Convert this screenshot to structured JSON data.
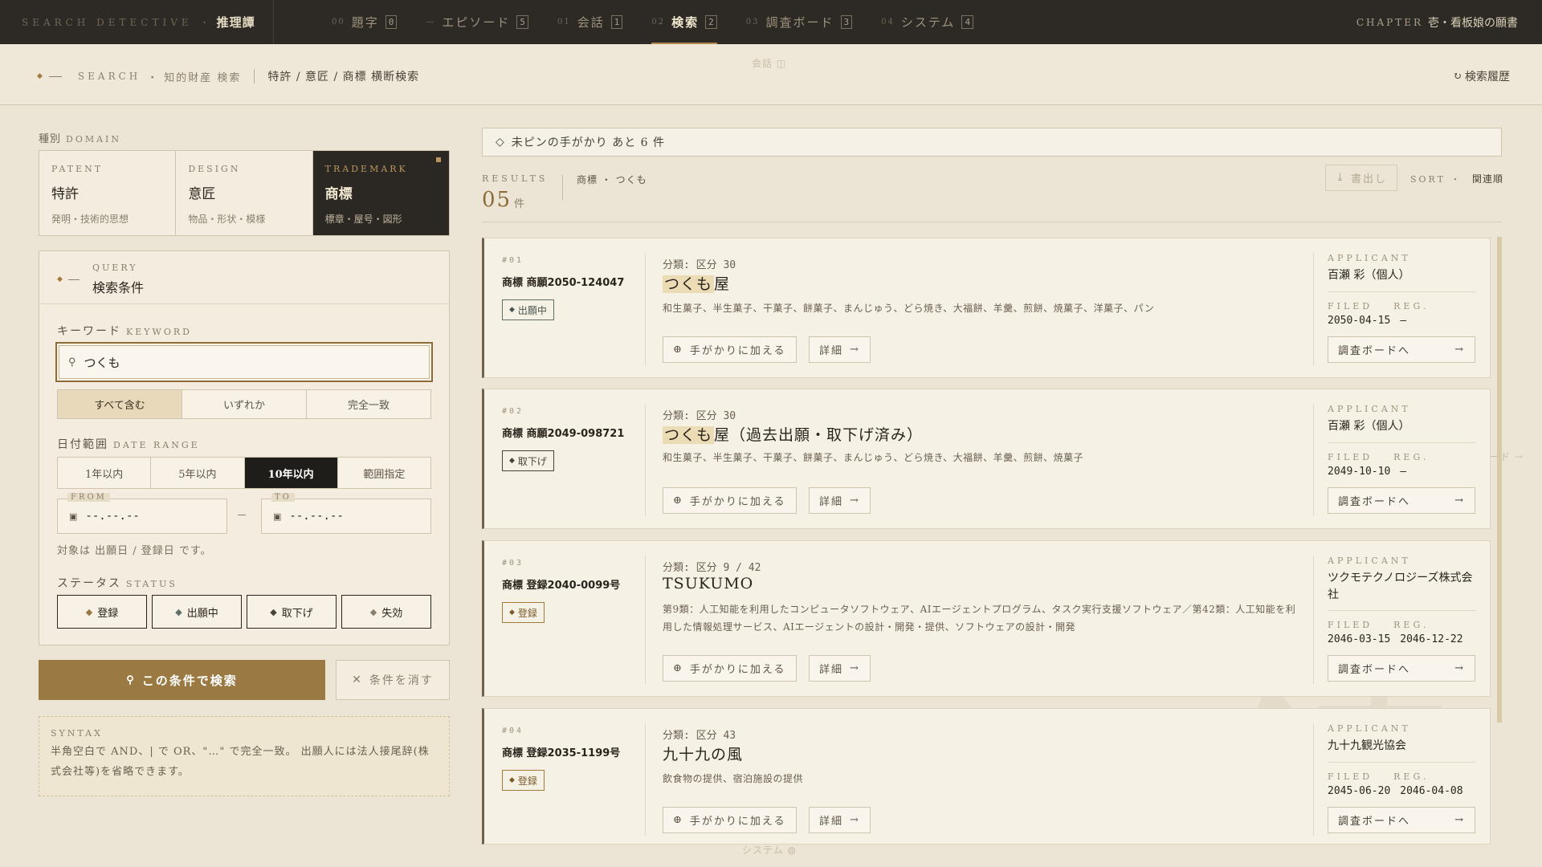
{
  "topbar": {
    "brand_en": "SEARCH DETECTIVE",
    "brand_dot": "・",
    "brand_jp": "推理譚",
    "tabs": [
      {
        "num": "00",
        "label": "題字",
        "key": "0"
      },
      {
        "num": "—",
        "label": "エピソード",
        "key": "5"
      },
      {
        "num": "01",
        "label": "会話",
        "key": "1"
      },
      {
        "num": "02",
        "label": "検索",
        "key": "2"
      },
      {
        "num": "03",
        "label": "調査ボード",
        "key": "3"
      },
      {
        "num": "04",
        "label": "システム",
        "key": "4"
      }
    ],
    "active_tab": "検索",
    "chapter_en": "CHAPTER",
    "chapter_jp": "壱・看板娘の願書"
  },
  "subheader": {
    "crumb_en": "SEARCH",
    "crumb_dot": "・",
    "crumb_jp": "知的財産 検索",
    "path": "特許 / 意匠 / 商標 横断検索",
    "history": "検索履歴",
    "ghost_top": "会話 ◫",
    "ghost_right": "ボード →",
    "ghost_bottom": "システム ◍"
  },
  "domain": {
    "label_jp": "種別",
    "label_en": "DOMAIN",
    "items": [
      {
        "en": "PATENT",
        "jp": "特許",
        "sub": "発明・技術的思想"
      },
      {
        "en": "DESIGN",
        "jp": "意匠",
        "sub": "物品・形状・模様"
      },
      {
        "en": "TRADEMARK",
        "jp": "商標",
        "sub": "標章・屋号・図形"
      }
    ]
  },
  "query": {
    "head_en": "QUERY",
    "head_jp": "検索条件",
    "keyword_jp": "キーワード",
    "keyword_en": "KEYWORD",
    "keyword_value": "つくも",
    "match_modes": [
      "すべて含む",
      "いずれか",
      "完全一致"
    ],
    "date_jp": "日付範囲",
    "date_en": "DATE RANGE",
    "date_ranges": [
      "1年以内",
      "5年以内",
      "10年以内",
      "範囲指定"
    ],
    "from_label": "FROM",
    "to_label": "TO",
    "from_value": "--.--.--",
    "to_value": "--.--.--",
    "date_note": "対象は 出願日 / 登録日 です。",
    "status_jp": "ステータス",
    "status_en": "STATUS",
    "statuses": [
      "登録",
      "出願中",
      "取下げ",
      "失効"
    ],
    "status_colors": [
      "#9a7a42",
      "#5f6e66",
      "#4b4236",
      "#8a7f6c"
    ]
  },
  "actions": {
    "search": "この条件で検索",
    "clear": "条件を消す"
  },
  "syntax": {
    "title": "SYNTAX",
    "body": "半角空白で AND、| で OR、\"…\" で完全一致。 出願人には法人接尾辞(株式会社等)を省略できます。"
  },
  "results": {
    "pin_text": "未ピンの手がかり あと 6 件",
    "label_en": "RESULTS",
    "count": "05",
    "count_unit": "件",
    "query_desc": "商標 ・ つくも",
    "export": "書出し",
    "sort_label": "SORT",
    "sort_dot": "・",
    "sort_value": "関連順",
    "cards": [
      {
        "no": "#01",
        "regno": "商標 商願2050-124047",
        "status": "出願中",
        "cls": "分類: 区分 30",
        "name_hl": "つくも",
        "name_rest": "屋",
        "goods": "和生菓子、半生菓子、干菓子、餅菓子、まんじゅう、どら焼き、大福餅、羊羹、煎餅、焼菓子、洋菓子、パン",
        "applicant": "百瀬 彩（個人）",
        "filed": "2050-04-15",
        "reg": "—"
      },
      {
        "no": "#02",
        "regno": "商標 商願2049-098721",
        "status": "取下げ",
        "cls": "分類: 区分 30",
        "name_hl": "つくも",
        "name_rest": "屋（過去出願・取下げ済み）",
        "goods": "和生菓子、半生菓子、干菓子、餅菓子、まんじゅう、どら焼き、大福餅、羊羹、煎餅、焼菓子",
        "applicant": "百瀬 彩（個人）",
        "filed": "2049-10-10",
        "reg": "—"
      },
      {
        "no": "#03",
        "regno": "商標 登録2040-0099号",
        "status": "登録",
        "cls": "分類: 区分 9 / 42",
        "name_hl": "",
        "name_rest": "TSUKUMO",
        "goods": "第9類：人工知能を利用したコンピュータソフトウェア、AIエージェントプログラム、タスク実行支援ソフトウェア／第42類：人工知能を利用した情報処理サービス、AIエージェントの設計・開発・提供、ソフトウェアの設計・開発",
        "applicant": "ツクモテクノロジーズ株式会社",
        "filed": "2046-03-15",
        "reg": "2046-12-22"
      },
      {
        "no": "#04",
        "regno": "商標 登録2035-1199号",
        "status": "登録",
        "cls": "分類: 区分 43",
        "name_hl": "",
        "name_rest": "九十九の風",
        "goods": "飲食物の提供、宿泊施設の提供",
        "applicant": "九十九観光協会",
        "filed": "2045-06-20",
        "reg": "2046-04-08"
      }
    ],
    "add_clue": "手がかりに加える",
    "detail": "詳細",
    "to_board": "調査ボードへ",
    "applicant_en": "APPLICANT",
    "filed_en": "FILED",
    "reg_en": "REG."
  },
  "watermark": "検",
  "colors": {
    "accent": "#9a7a42",
    "dark": "#2d2a25",
    "background": "#ece5d6"
  }
}
